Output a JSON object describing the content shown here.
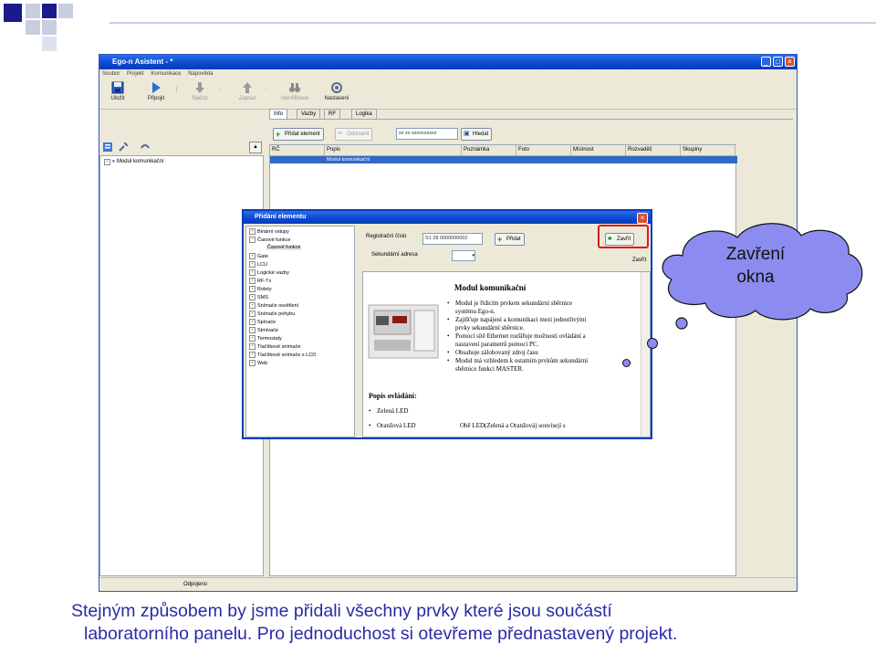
{
  "app": {
    "title": "Ego-n Asistent - *",
    "menu": [
      "Soubor",
      "Projekt",
      "Komunikace",
      "Nápověda"
    ],
    "toolbar": [
      {
        "label": "Uložit",
        "icon": "save-icon",
        "enabled": true
      },
      {
        "label": "Připojit",
        "icon": "connect-icon",
        "enabled": true
      },
      {
        "label": "Načíst",
        "icon": "download-icon",
        "enabled": false
      },
      {
        "label": "Zapsat",
        "icon": "upload-icon",
        "enabled": false
      },
      {
        "label": "Identifikace",
        "icon": "binoculars-icon",
        "enabled": false
      },
      {
        "label": "Nastavení",
        "icon": "gear-icon",
        "enabled": true
      }
    ],
    "tabs": [
      "Info",
      "Vazby",
      "RF",
      "Logika"
    ],
    "actions": {
      "add": "Přidat element",
      "remove": "Odstranit",
      "search_value": "xx xx xxxxxxxxxx",
      "search": "Hledat"
    },
    "columns": [
      "RČ",
      "Popis",
      "Poznámka",
      "Foto",
      "Místnost",
      "Rozvaděč",
      "Skupiny"
    ],
    "rows": [
      {
        "rc": "",
        "popis": "Modul komunikační"
      }
    ],
    "tree_root": "Modul komunikační",
    "status": "Odpojeno"
  },
  "dialog": {
    "title": "Přidání elementu",
    "tree": [
      {
        "label": "Binární vstupy",
        "level": 0,
        "expanded": false
      },
      {
        "label": "Časové funkce",
        "level": 0,
        "expanded": true
      },
      {
        "label": "Časové funkce",
        "level": 1,
        "selected": true
      },
      {
        "label": "Gate",
        "level": 0,
        "expanded": false
      },
      {
        "label": "LCU",
        "level": 0,
        "expanded": false
      },
      {
        "label": "Logické vazby",
        "level": 0,
        "expanded": false
      },
      {
        "label": "RF-Tx",
        "level": 0,
        "expanded": false
      },
      {
        "label": "Rolety",
        "level": 0,
        "expanded": false
      },
      {
        "label": "SMS",
        "level": 0,
        "expanded": false
      },
      {
        "label": "Snímače osvětlení",
        "level": 0,
        "expanded": false
      },
      {
        "label": "Snímače pohybu",
        "level": 0,
        "expanded": false
      },
      {
        "label": "Spínače",
        "level": 0,
        "expanded": false
      },
      {
        "label": "Stmívače",
        "level": 0,
        "expanded": false
      },
      {
        "label": "Termostaty",
        "level": 0,
        "expanded": false
      },
      {
        "label": "Tlačítkové snímače",
        "level": 0,
        "expanded": false
      },
      {
        "label": "Tlačítkové snímače s LCD",
        "level": 0,
        "expanded": false
      },
      {
        "label": "Web",
        "level": 0,
        "expanded": false
      }
    ],
    "reg_label": "Registrační číslo",
    "reg_value": "S1 28 0000000002",
    "add_button": "Přidat",
    "close_button": "Zavřít",
    "sec_label": "Sekundární adresa",
    "close_button_2": "Zavřít",
    "doc": {
      "heading": "Modul komunikační",
      "bullets": [
        "Modul je řídicím prvkem sekundární sběrnice",
        "systému Ego-n.",
        "Zajišťuje napájení a komunikaci mezi jednotlivými",
        "prvky sekundární sběrnice.",
        "Pomocí sítě Ethernet rozšiřuje možnosti ovládání a",
        "nastavení parametrů pomocí PC.",
        "Obsahuje zálohovaný zdroj času",
        "Modul má vzhledem k ostatním prvkům sekundární",
        "sběrnice funkci MASTER."
      ],
      "section": "Popis ovládání:",
      "items": [
        "Zelená LED",
        "Oranžová LED"
      ],
      "desc": "Obě LED(Zelená a Oranžová) souvisejí s"
    }
  },
  "callout": {
    "line1": "Zavření",
    "line2": "okna"
  },
  "caption": {
    "line1": "Stejným způsobem by jsme přidali všechny prvky které jsou součástí",
    "line2": "laboratorního panelu. Pro  jednoduchost si otevřeme přednastavený projekt."
  },
  "colors": {
    "caption": "#2a2aa8",
    "cloud": "#8c8cf0",
    "highlight": "#e01818",
    "titlebar": "#0b47d0"
  }
}
